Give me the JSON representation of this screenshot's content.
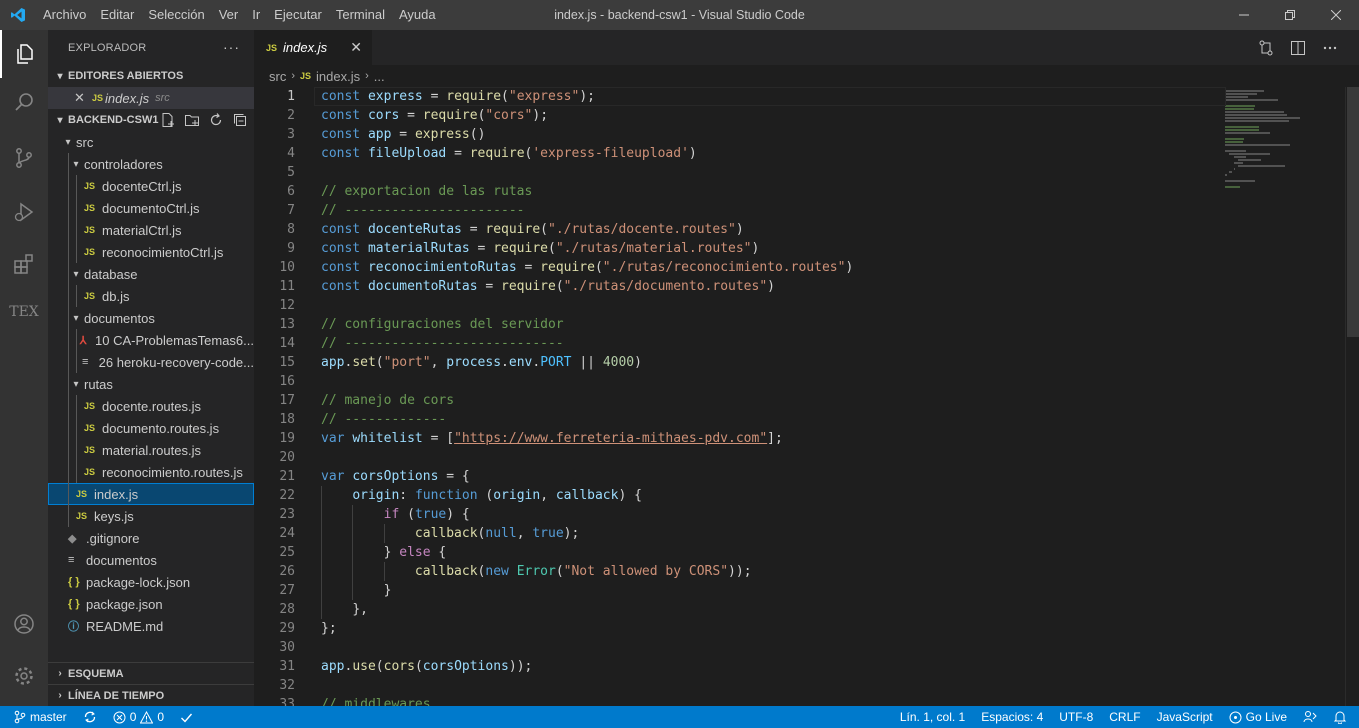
{
  "titlebar": {
    "menu": [
      "Archivo",
      "Editar",
      "Selección",
      "Ver",
      "Ir",
      "Ejecutar",
      "Terminal",
      "Ayuda"
    ],
    "title": "index.js - backend-csw1 - Visual Studio Code"
  },
  "activity": [
    "explorer-icon",
    "search-icon",
    "source-control-icon",
    "run-debug-icon",
    "extensions-icon",
    "tex-icon",
    "account-icon",
    "settings-gear-icon"
  ],
  "activity_tex_label": "TEX",
  "sidebar": {
    "title": "EXPLORADOR",
    "more": "···",
    "open_editors_header": "EDITORES ABIERTOS",
    "open_editor": {
      "name": "index.js",
      "dir": "src"
    },
    "project_header": "BACKEND-CSW1",
    "tree": [
      {
        "name": "src",
        "type": "folder"
      },
      {
        "name": "controladores",
        "type": "folder"
      },
      {
        "name": "docenteCtrl.js",
        "type": "js"
      },
      {
        "name": "documentoCtrl.js",
        "type": "js"
      },
      {
        "name": "materialCtrl.js",
        "type": "js"
      },
      {
        "name": "reconocimientoCtrl.js",
        "type": "js"
      },
      {
        "name": "database",
        "type": "folder"
      },
      {
        "name": "db.js",
        "type": "js"
      },
      {
        "name": "documentos",
        "type": "folder"
      },
      {
        "name": "10 CA-ProblemasTemas6...",
        "type": "pdf"
      },
      {
        "name": "26 heroku-recovery-code...",
        "type": "txt"
      },
      {
        "name": "rutas",
        "type": "folder"
      },
      {
        "name": "docente.routes.js",
        "type": "js"
      },
      {
        "name": "documento.routes.js",
        "type": "js"
      },
      {
        "name": "material.routes.js",
        "type": "js"
      },
      {
        "name": "reconocimiento.routes.js",
        "type": "js"
      },
      {
        "name": "index.js",
        "type": "js"
      },
      {
        "name": "keys.js",
        "type": "js"
      },
      {
        "name": ".gitignore",
        "type": "git"
      },
      {
        "name": "documentos",
        "type": "txt"
      },
      {
        "name": "package-lock.json",
        "type": "json"
      },
      {
        "name": "package.json",
        "type": "json"
      },
      {
        "name": "README.md",
        "type": "info"
      }
    ],
    "outline_header": "ESQUEMA",
    "timeline_header": "LÍNEA DE TIEMPO"
  },
  "icons": {
    "js": "JS",
    "json": "{ }",
    "close": "✕"
  },
  "tab": {
    "name": "index.js"
  },
  "breadcrumb": {
    "folder": "src",
    "file": "index.js",
    "more": "..."
  },
  "code": [
    "const express = require(\"express\");",
    "const cors = require(\"cors\");",
    "const app = express()",
    "const fileUpload = require('express-fileupload')",
    "",
    "// exportacion de las rutas",
    "// -----------------------",
    "const docenteRutas = require(\"./rutas/docente.routes\")",
    "const materialRutas = require(\"./rutas/material.routes\")",
    "const reconocimientoRutas = require(\"./rutas/reconocimiento.routes\")",
    "const documentoRutas = require(\"./rutas/documento.routes\")",
    "",
    "// configuraciones del servidor",
    "// ----------------------------",
    "app.set(\"port\", process.env.PORT || 4000)",
    "",
    "// manejo de cors",
    "// -------------",
    "var whitelist = [\"https://www.ferreteria-mithaes-pdv.com\"];",
    "",
    "var corsOptions = {",
    "    origin: function (origin, callback) {",
    "        if (true) {",
    "            callback(null, true);",
    "        } else {",
    "            callback(new Error(\"Not allowed by CORS\"));",
    "        }",
    "    },",
    "};",
    "",
    "app.use(cors(corsOptions));",
    "",
    "// middlewares"
  ],
  "statusbar": {
    "branch": "master",
    "errors": "0",
    "warnings": "0",
    "position": "Lín. 1, col. 1",
    "spaces": "Espacios: 4",
    "encoding": "UTF-8",
    "eol": "CRLF",
    "language": "JavaScript",
    "golive": "Go Live"
  },
  "colors": {
    "accent": "#007acc",
    "selection": "#094771"
  }
}
